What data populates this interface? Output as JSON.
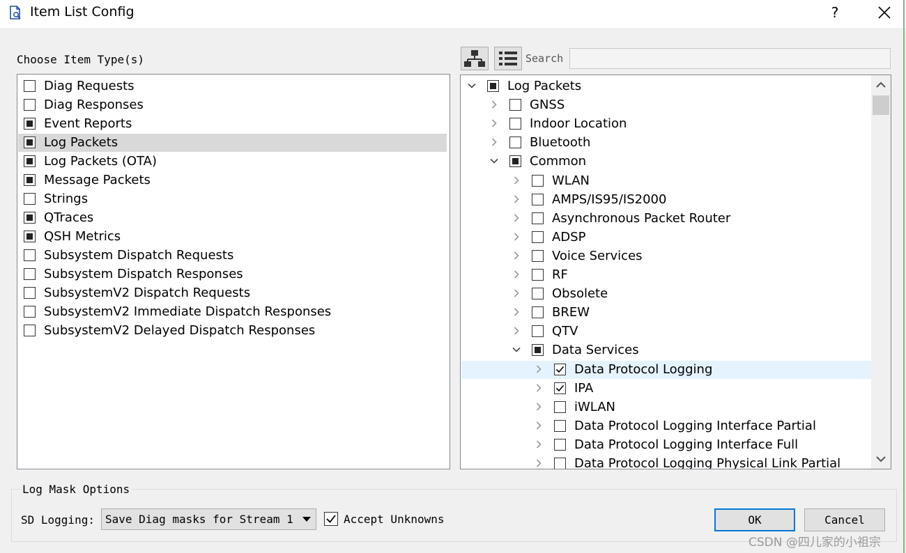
{
  "window": {
    "title": "Item List Config",
    "help": "?"
  },
  "left": {
    "heading": "Choose Item Type(s)",
    "items": [
      {
        "label": "Diag Requests",
        "state": "unchecked",
        "selected": false
      },
      {
        "label": "Diag Responses",
        "state": "unchecked",
        "selected": false
      },
      {
        "label": "Event Reports",
        "state": "partial",
        "selected": false
      },
      {
        "label": "Log Packets",
        "state": "partial",
        "selected": true
      },
      {
        "label": "Log Packets (OTA)",
        "state": "partial",
        "selected": false
      },
      {
        "label": "Message Packets",
        "state": "partial",
        "selected": false
      },
      {
        "label": "Strings",
        "state": "unchecked",
        "selected": false
      },
      {
        "label": "QTraces",
        "state": "partial",
        "selected": false
      },
      {
        "label": "QSH Metrics",
        "state": "partial",
        "selected": false
      },
      {
        "label": "Subsystem Dispatch Requests",
        "state": "unchecked",
        "selected": false
      },
      {
        "label": "Subsystem Dispatch Responses",
        "state": "unchecked",
        "selected": false
      },
      {
        "label": "SubsystemV2 Dispatch Requests",
        "state": "unchecked",
        "selected": false
      },
      {
        "label": "SubsystemV2 Immediate Dispatch Responses",
        "state": "unchecked",
        "selected": false
      },
      {
        "label": "SubsystemV2 Delayed Dispatch Responses",
        "state": "unchecked",
        "selected": false
      }
    ]
  },
  "search": {
    "label": "Search",
    "value": "",
    "placeholder": ""
  },
  "tree": [
    {
      "label": "Log Packets",
      "level": 0,
      "expanded": true,
      "state": "partial"
    },
    {
      "label": "GNSS",
      "level": 1,
      "expanded": false,
      "state": "unchecked"
    },
    {
      "label": "Indoor Location",
      "level": 1,
      "expanded": false,
      "state": "unchecked"
    },
    {
      "label": "Bluetooth",
      "level": 1,
      "expanded": false,
      "state": "unchecked"
    },
    {
      "label": "Common",
      "level": 1,
      "expanded": true,
      "state": "partial"
    },
    {
      "label": "WLAN",
      "level": 2,
      "expanded": false,
      "state": "unchecked"
    },
    {
      "label": "AMPS/IS95/IS2000",
      "level": 2,
      "expanded": false,
      "state": "unchecked"
    },
    {
      "label": "Asynchronous Packet Router",
      "level": 2,
      "expanded": false,
      "state": "unchecked"
    },
    {
      "label": "ADSP",
      "level": 2,
      "expanded": false,
      "state": "unchecked"
    },
    {
      "label": "Voice Services",
      "level": 2,
      "expanded": false,
      "state": "unchecked"
    },
    {
      "label": "RF",
      "level": 2,
      "expanded": false,
      "state": "unchecked"
    },
    {
      "label": "Obsolete",
      "level": 2,
      "expanded": false,
      "state": "unchecked"
    },
    {
      "label": "BREW",
      "level": 2,
      "expanded": false,
      "state": "unchecked"
    },
    {
      "label": "QTV",
      "level": 2,
      "expanded": false,
      "state": "unchecked"
    },
    {
      "label": "Data Services",
      "level": 2,
      "expanded": true,
      "state": "partial"
    },
    {
      "label": "Data Protocol Logging",
      "level": 3,
      "expanded": false,
      "state": "checked",
      "highlight": true
    },
    {
      "label": "IPA",
      "level": 3,
      "expanded": false,
      "state": "checked"
    },
    {
      "label": "iWLAN",
      "level": 3,
      "expanded": false,
      "state": "unchecked"
    },
    {
      "label": "Data Protocol Logging Interface Partial",
      "level": 3,
      "expanded": false,
      "state": "unchecked"
    },
    {
      "label": "Data Protocol Logging Interface Full",
      "level": 3,
      "expanded": false,
      "state": "unchecked"
    },
    {
      "label": "Data Protocol Logging Physical Link Partial",
      "level": 3,
      "expanded": false,
      "state": "unchecked"
    }
  ],
  "options": {
    "group_title": "Log Mask Options",
    "sd_label": "SD Logging:",
    "sd_value": "Save Diag masks for Stream 1",
    "accept_label": "Accept Unknowns",
    "accept_checked": true
  },
  "buttons": {
    "ok": "OK",
    "cancel": "Cancel"
  },
  "watermark": "CSDN @四儿家的小祖宗"
}
